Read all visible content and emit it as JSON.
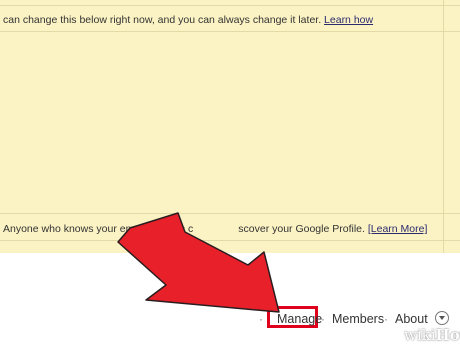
{
  "notice_top": {
    "text": "can change this below right now, and you can always change it later.",
    "link": "Learn how"
  },
  "notice_bottom": {
    "text_before": "Anyone who knows your email address c",
    "text_after": "scover your Google Profile.",
    "link": "[Learn More]"
  },
  "nav": {
    "manage": "Manage",
    "members": "Members",
    "about": "About",
    "separator": "·"
  },
  "watermark": {
    "part1": "wiki",
    "part2": "How"
  },
  "colors": {
    "notice_bg": "#fbf3c4",
    "highlight_border": "#e0001b",
    "arrow": "#e8202a"
  },
  "icons": {
    "dropdown": "chevron-down-circle-icon",
    "pointer": "red-pointer-arrow"
  }
}
